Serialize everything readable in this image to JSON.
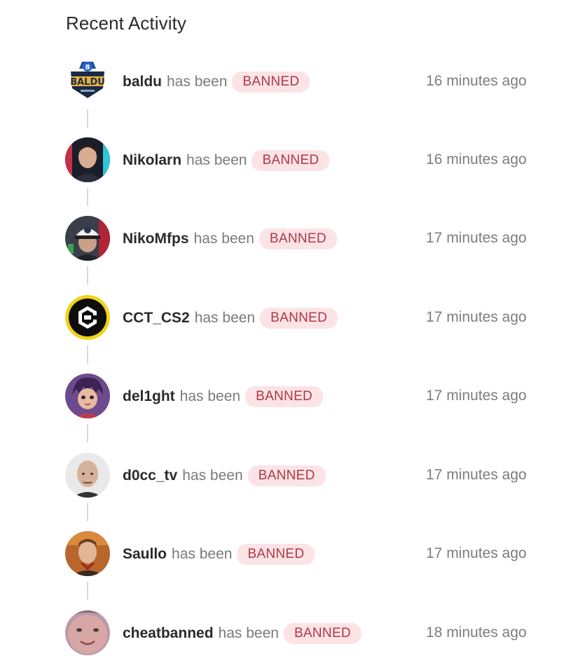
{
  "header": {
    "title": "Recent Activity"
  },
  "colors": {
    "badge_bg": "#fbe3e6",
    "badge_text": "#b03845",
    "connector": "#d9d9d9"
  },
  "activity": [
    {
      "user": "baldu",
      "verb": "has been",
      "status": "BANNED",
      "time": "16 minutes ago",
      "avatar_icon": "baldu-logo-avatar"
    },
    {
      "user": "Nikolarn",
      "verb": "has been",
      "status": "BANNED",
      "time": "16 minutes ago",
      "avatar_icon": "person-avatar"
    },
    {
      "user": "NikoMfps",
      "verb": "has been",
      "status": "BANNED",
      "time": "17 minutes ago",
      "avatar_icon": "person-cap-avatar"
    },
    {
      "user": "CCT_CS2",
      "verb": "has been",
      "status": "BANNED",
      "time": "17 minutes ago",
      "avatar_icon": "cct-logo-avatar"
    },
    {
      "user": "del1ght",
      "verb": "has been",
      "status": "BANNED",
      "time": "17 minutes ago",
      "avatar_icon": "cartoon-avatar"
    },
    {
      "user": "d0cc_tv",
      "verb": "has been",
      "status": "BANNED",
      "time": "17 minutes ago",
      "avatar_icon": "person-bald-avatar"
    },
    {
      "user": "Saullo",
      "verb": "has been",
      "status": "BANNED",
      "time": "17 minutes ago",
      "avatar_icon": "person-avatar"
    },
    {
      "user": "cheatbanned",
      "verb": "has been",
      "status": "BANNED",
      "time": "18 minutes ago",
      "avatar_icon": "face-closeup-avatar"
    }
  ]
}
